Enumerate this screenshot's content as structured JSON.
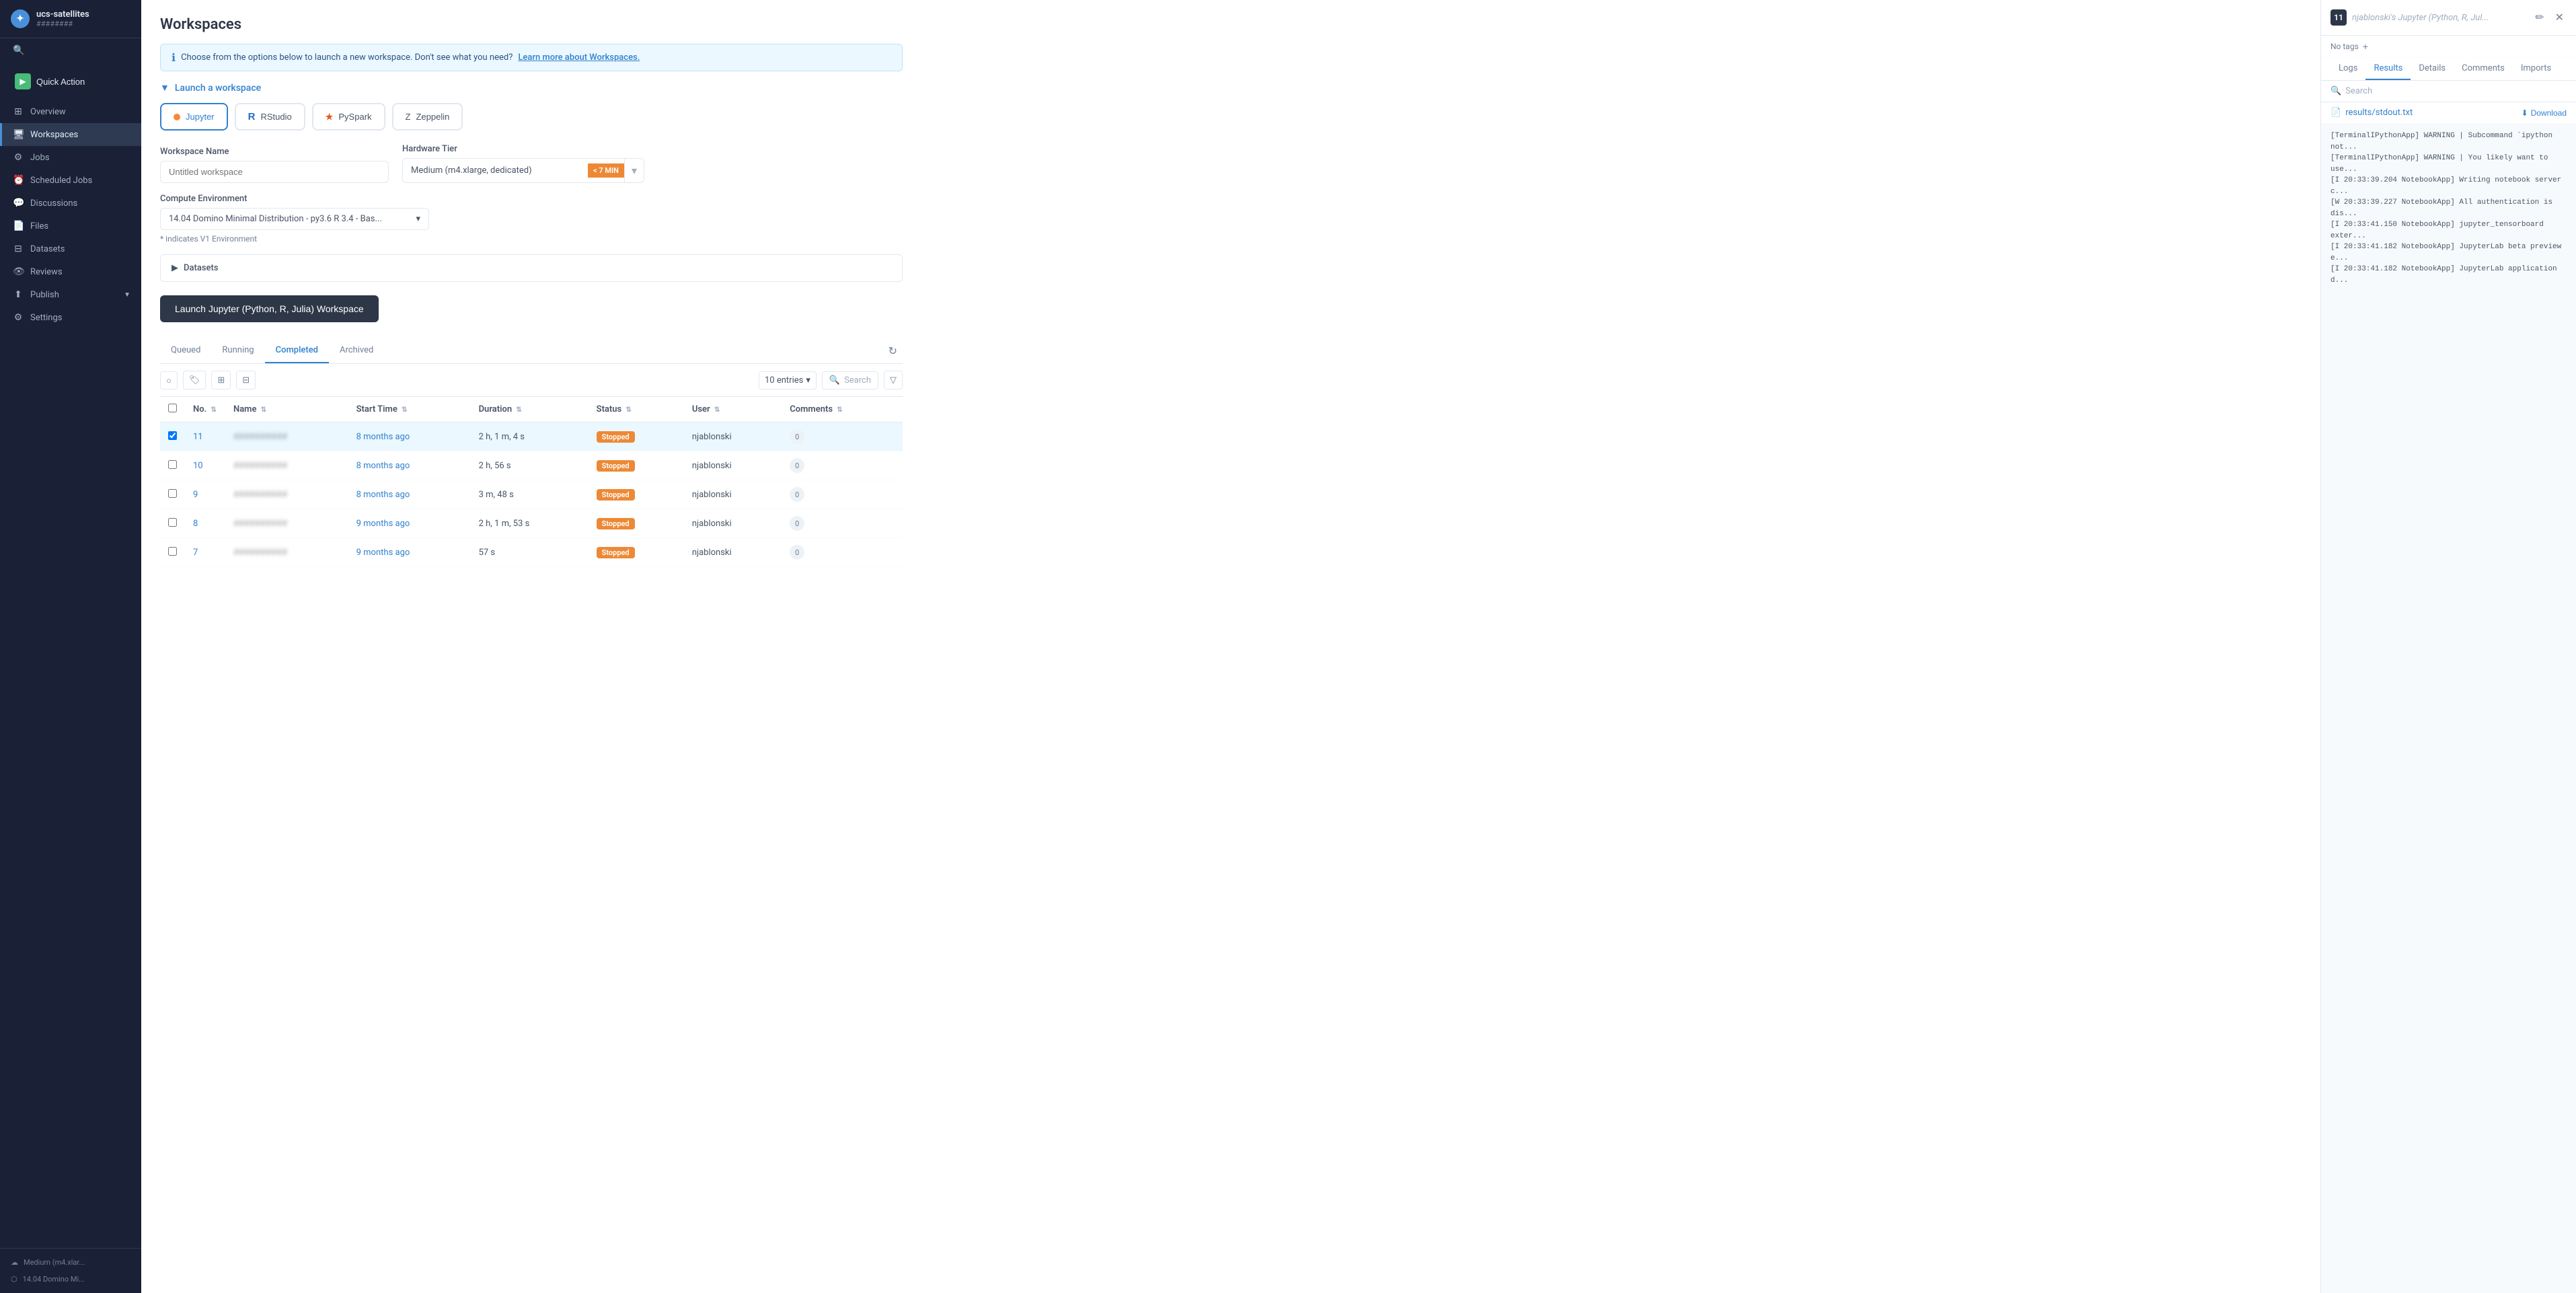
{
  "app": {
    "project_name": "ucs-satellites",
    "project_sub": "########"
  },
  "sidebar": {
    "quick_action_label": "Quick Action",
    "nav_items": [
      {
        "id": "overview",
        "label": "Overview",
        "icon": "⊞"
      },
      {
        "id": "workspaces",
        "label": "Workspaces",
        "icon": "🖥",
        "active": true
      },
      {
        "id": "jobs",
        "label": "Jobs",
        "icon": "⚙"
      },
      {
        "id": "scheduled-jobs",
        "label": "Scheduled Jobs",
        "icon": "⏰"
      },
      {
        "id": "discussions",
        "label": "Discussions",
        "icon": "💬"
      },
      {
        "id": "files",
        "label": "Files",
        "icon": "📄"
      },
      {
        "id": "datasets",
        "label": "Datasets",
        "icon": "⊟"
      },
      {
        "id": "reviews",
        "label": "Reviews",
        "icon": "👁"
      },
      {
        "id": "publish",
        "label": "Publish",
        "icon": "⬆",
        "has_expand": true
      },
      {
        "id": "settings",
        "label": "Settings",
        "icon": "⚙"
      }
    ],
    "env_items": [
      {
        "label": "Medium (m4.xlar..."
      },
      {
        "label": "14.04 Domino Mi..."
      }
    ]
  },
  "main": {
    "page_title": "Workspaces",
    "info_text": "Choose from the options below to launch a new workspace. Don't see what you need?",
    "info_link": "Learn more about Workspaces.",
    "launch_section_label": "Launch a workspace",
    "workspace_types": [
      {
        "id": "jupyter",
        "label": "Jupyter",
        "selected": true
      },
      {
        "id": "rstudio",
        "label": "RStudio"
      },
      {
        "id": "pyspark",
        "label": "PySpark"
      },
      {
        "id": "zeppelin",
        "label": "Zeppelin"
      }
    ],
    "workspace_name_label": "Workspace Name",
    "workspace_name_placeholder": "Untitled workspace",
    "hardware_tier_label": "Hardware Tier",
    "hardware_tier_value": "Medium (m4.xlarge, dedicated)",
    "hardware_tier_badge": "< 7 MIN",
    "compute_env_label": "Compute Environment",
    "compute_env_value": "14.04 Domino Minimal Distribution - py3.6 R 3.4 - Bas...",
    "indicates_text": "* indicates V1 Environment",
    "datasets_label": "Datasets",
    "launch_btn_label": "Launch Jupyter (Python, R, Julia) Workspace",
    "tabs": [
      {
        "id": "queued",
        "label": "Queued"
      },
      {
        "id": "running",
        "label": "Running"
      },
      {
        "id": "completed",
        "label": "Completed",
        "active": true
      },
      {
        "id": "archived",
        "label": "Archived"
      }
    ],
    "table": {
      "entries_label": "10 entries",
      "search_placeholder": "Search",
      "columns": [
        "No.",
        "Name",
        "Start Time",
        "Duration",
        "Status",
        "User",
        "Comments"
      ],
      "rows": [
        {
          "no": "11",
          "name": "##########",
          "start": "8 months ago",
          "duration": "2 h, 1 m, 4 s",
          "status": "Stopped",
          "user": "njablonski",
          "comments": "0",
          "selected": true
        },
        {
          "no": "10",
          "name": "##########",
          "start": "8 months ago",
          "duration": "2 h, 56 s",
          "status": "Stopped",
          "user": "njablonski",
          "comments": "0",
          "selected": false
        },
        {
          "no": "9",
          "name": "##########",
          "start": "8 months ago",
          "duration": "3 m, 48 s",
          "status": "Stopped",
          "user": "njablonski",
          "comments": "0",
          "selected": false
        },
        {
          "no": "8",
          "name": "##########",
          "start": "9 months ago",
          "duration": "2 h, 1 m, 53 s",
          "status": "Stopped",
          "user": "njablonski",
          "comments": "0",
          "selected": false
        },
        {
          "no": "7",
          "name": "##########",
          "start": "9 months ago",
          "duration": "57 s",
          "status": "Stopped",
          "user": "njablonski",
          "comments": "0",
          "selected": false
        }
      ]
    }
  },
  "right_panel": {
    "num": "11",
    "title": "njablonski's Jupyter (Python, R, Jul...",
    "no_tags_label": "No tags",
    "add_tag_icon": "+",
    "tabs": [
      {
        "id": "logs",
        "label": "Logs"
      },
      {
        "id": "results",
        "label": "Results",
        "active": true
      },
      {
        "id": "details",
        "label": "Details"
      },
      {
        "id": "comments",
        "label": "Comments"
      },
      {
        "id": "imports",
        "label": "Imports"
      }
    ],
    "search_placeholder": "Search",
    "file": {
      "name": "results/stdout.txt",
      "download_label": "Download"
    },
    "logs": [
      "[TerminalIPythonApp] WARNING | Subcommand `ipython not...",
      "[TerminalIPythonApp] WARNING | You likely want to use...",
      "[I 20:33:39.204 NotebookApp] Writing notebook server c...",
      "[W 20:33:39.227 NotebookApp] All authentication is dis...",
      "[I 20:33:41.150 NotebookApp] jupyter_tensorboard exter...",
      "[I 20:33:41.182 NotebookApp] JupyterLab beta preview e...",
      "[I 20:33:41.182 NotebookApp] JupyterLab application d..."
    ]
  }
}
